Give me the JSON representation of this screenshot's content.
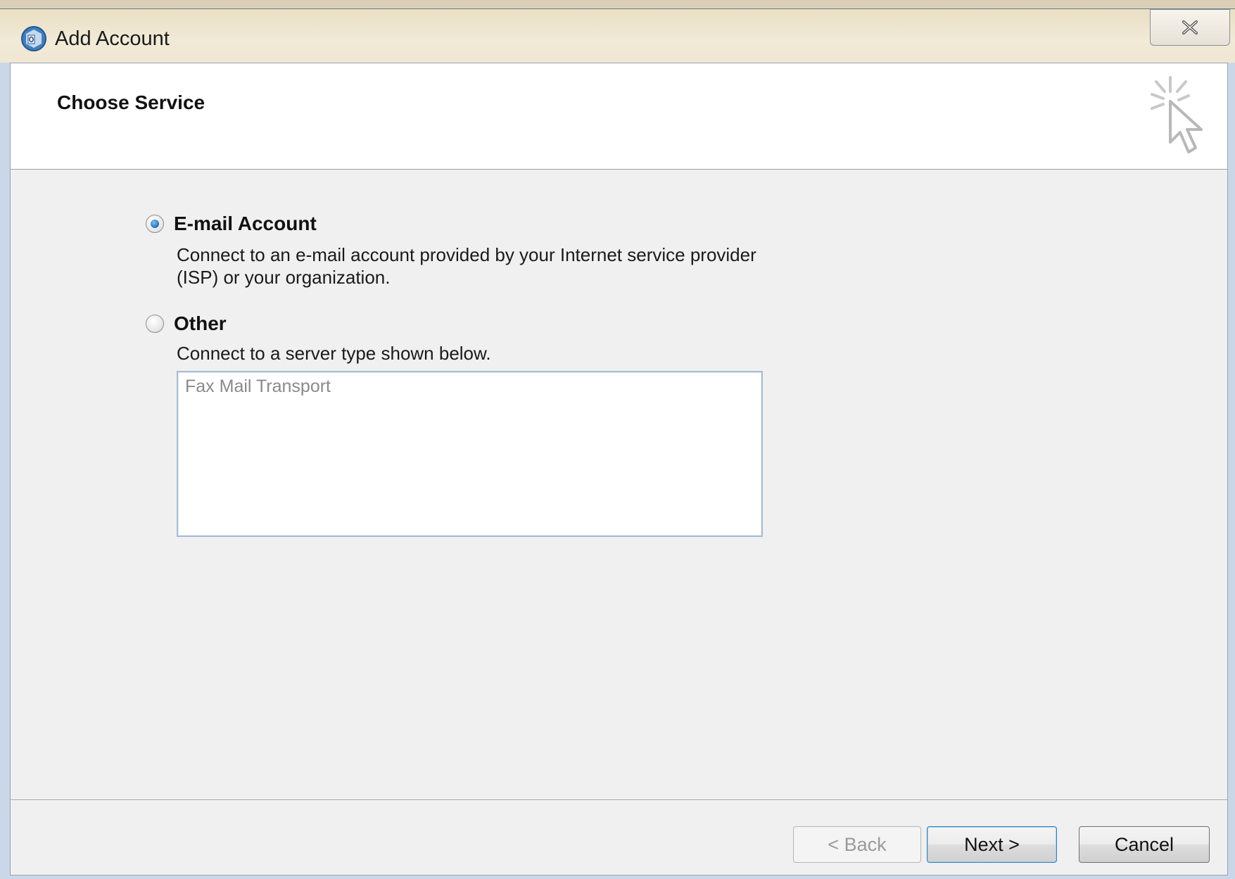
{
  "window": {
    "title": "Add Account",
    "close_glyph": "✕"
  },
  "header": {
    "title": "Choose Service",
    "icon": "cursor-sparkle-icon"
  },
  "options": [
    {
      "label": "E-mail Account",
      "checked": true,
      "description_line1": "Connect to an e-mail account provided by your Internet service provider",
      "description_line2": "(ISP) or your organization."
    },
    {
      "label": "Other",
      "checked": false,
      "description_line1": "Connect to a server type shown below."
    }
  ],
  "server_list": {
    "items": [
      "Fax Mail Transport"
    ]
  },
  "buttons": {
    "back": "< Back",
    "next": "Next >",
    "cancel": "Cancel"
  },
  "colors": {
    "radio_selected": "#1d6fb8",
    "list_border": "#a7bdd6"
  }
}
